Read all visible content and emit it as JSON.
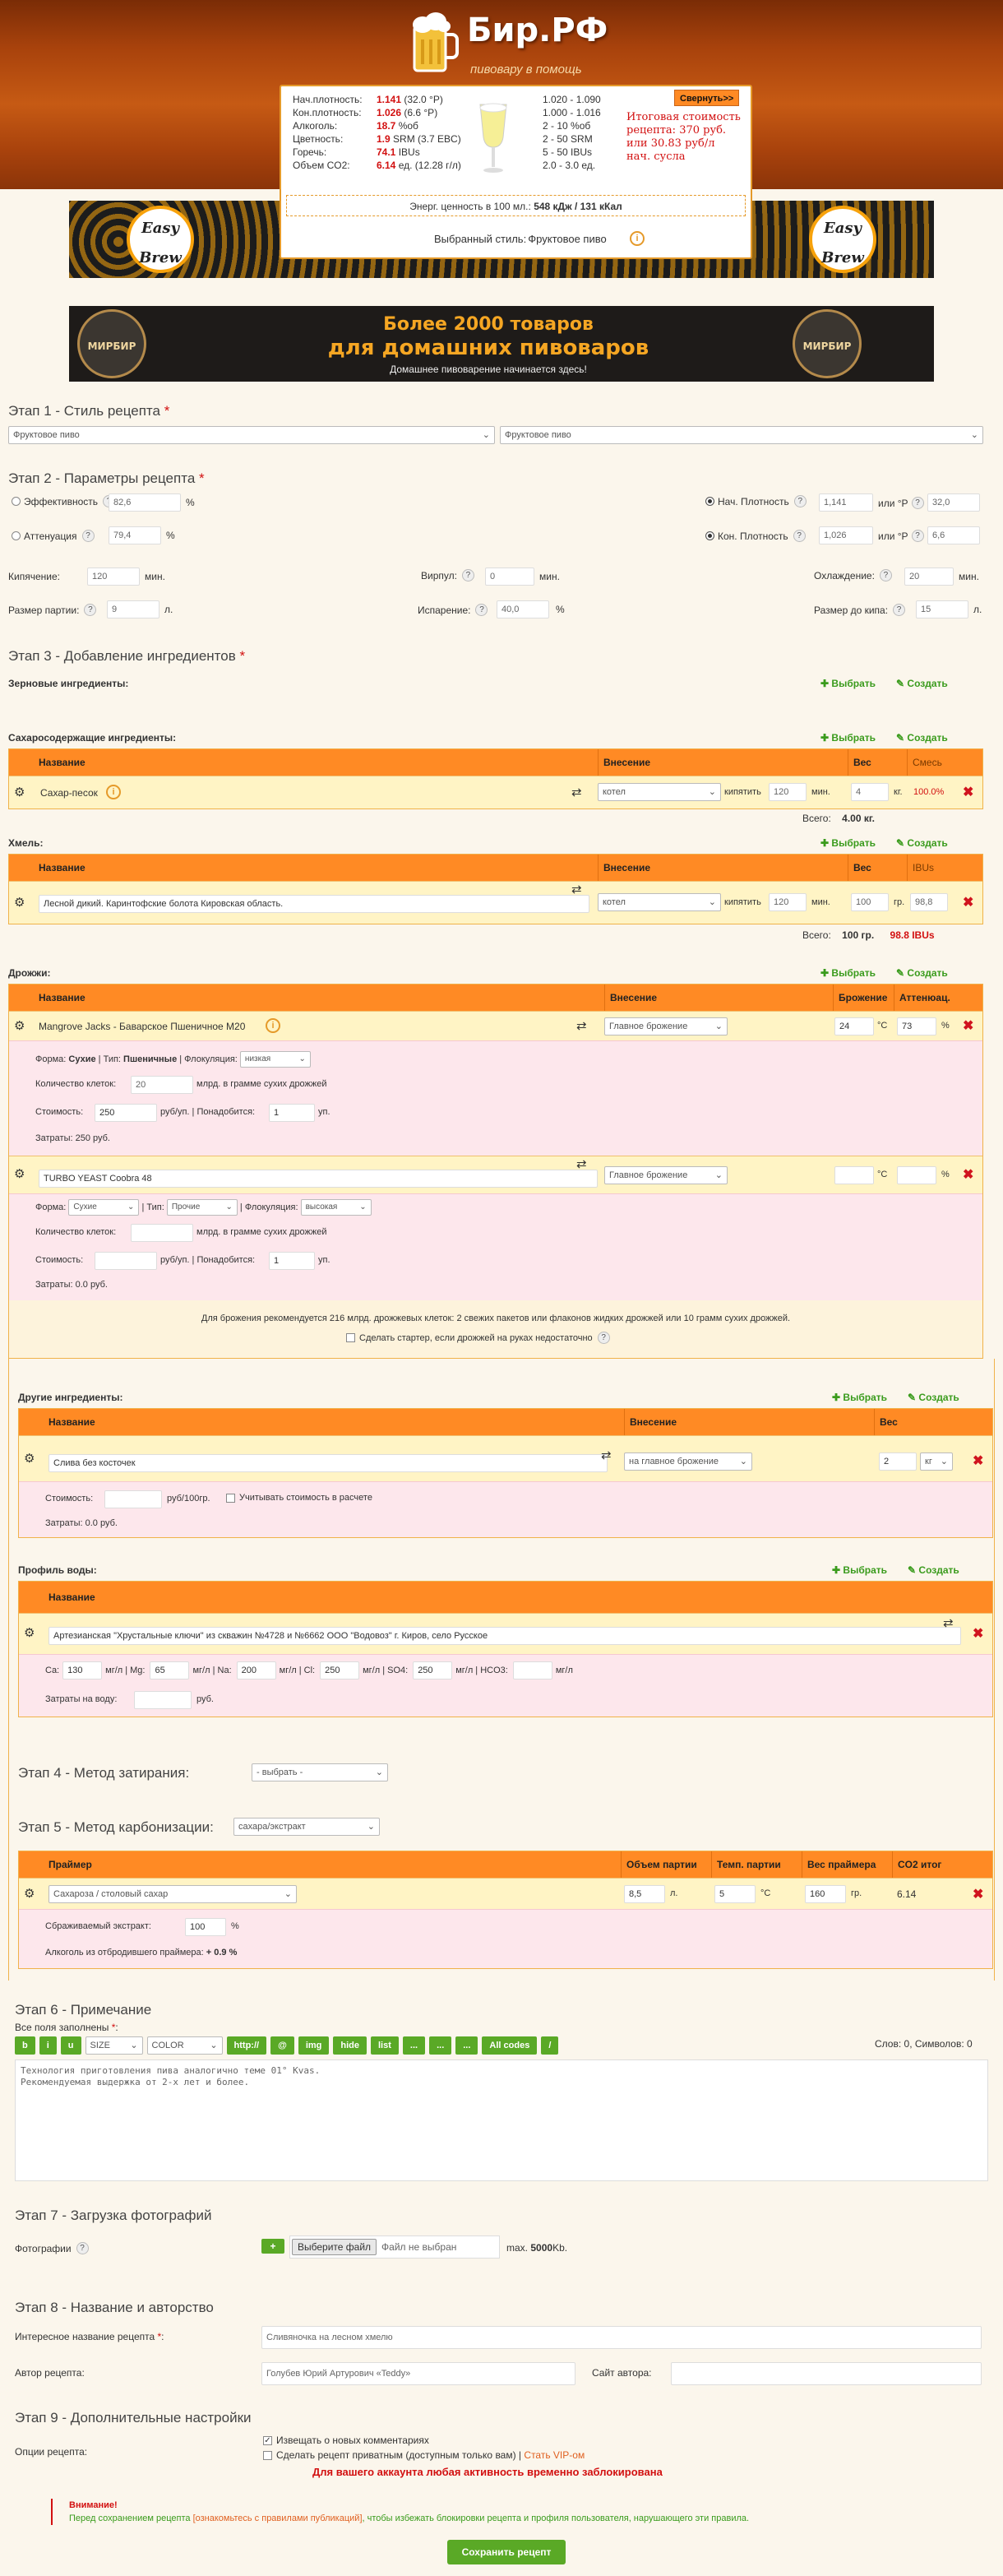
{
  "header": {
    "title": "Бир.РФ",
    "subtitle": "пивовару в помощь"
  },
  "calc": {
    "og_label": "Нач.плотность:",
    "og_value": "1.141",
    "og_extra": "(32.0 °P)",
    "og_range": "1.020 - 1.090",
    "fg_label": "Кон.плотность:",
    "fg_value": "1.026",
    "fg_extra": "(6.6 °P)",
    "fg_range": "1.000 - 1.016",
    "abv_label": "Алкоголь:",
    "abv_value": "18.7",
    "abv_unit": "%об",
    "abv_range": "2 - 10 %об",
    "color_label": "Цветность:",
    "color_value": "1.9",
    "color_unit": "SRM (3.7 EBC)",
    "color_range": "2 - 50 SRM",
    "ibu_label": "Горечь:",
    "ibu_value": "74.1",
    "ibu_unit": "IBUs",
    "ibu_range": "5 - 50 IBUs",
    "co2_label": "Объем CO2:",
    "co2_value": "6.14",
    "co2_unit": "ед. (12.28 г/л)",
    "co2_range": "2.0 - 3.0 ед.",
    "collapse": "Свернуть>>",
    "cost": "Итоговая стоимость рецепта: 370 руб. или 30.83 руб/л нач. сусла",
    "energy_label": "Энерг. ценность в 100 мл.:",
    "energy_value": "548 кДж / 131 кКал",
    "style_label": "Выбранный стиль:",
    "style_value": "Фруктовое пиво"
  },
  "banners": {
    "easybrew": "Easy Brew",
    "mirbir_logo": "МИРБИР",
    "mirbir_line1": "Более 2000 товаров",
    "mirbir_line2": "для домашних пивоваров",
    "mirbir_line3": "Домашнее пивоварение начинается здесь!"
  },
  "stage1": {
    "title": "Этап 1 - Стиль рецепта",
    "style1": "Фруктовое пиво",
    "style2": "Фруктовое пиво"
  },
  "stage2": {
    "title": "Этап 2 - Параметры рецепта",
    "efficiency_label": "Эффективность",
    "efficiency_value": "82,6",
    "pct": "%",
    "attenuation_label": "Аттенуация",
    "attenuation_value": "79,4",
    "og_label": "Нач. Плотность",
    "og_value": "1,141",
    "og_or": "или °P",
    "og_p": "32,0",
    "fg_label": "Кон. Плотность",
    "fg_value": "1,026",
    "fg_or": "или °P",
    "fg_p": "6,6",
    "boil_label": "Кипячение:",
    "boil_value": "120",
    "min": "мин.",
    "whirlpool_label": "Вирпул:",
    "whirlpool_value": "0",
    "cooling_label": "Охлаждение:",
    "cooling_value": "20",
    "batch_label": "Размер партии:",
    "batch_value": "9",
    "liter": "л.",
    "evap_label": "Испарение:",
    "evap_value": "40,0",
    "evap_unit": "%",
    "preboil_label": "Размер до кипа:",
    "preboil_value": "15"
  },
  "stage3": {
    "title": "Этап 3 - Добавление ингредиентов",
    "grains_label": "Зерновые ингредиенты:",
    "select": "Выбрать",
    "create": "Создать",
    "sugars_label": "Сахаросодержащие ингредиенты:",
    "sugar_headers": {
      "name": "Название",
      "addition": "Внесение",
      "weight": "Вес",
      "mix": "Смесь"
    },
    "sugar_row": {
      "name": "Сахар-песок",
      "addition": "котел",
      "boil": "кипятить",
      "time": "120",
      "min": "мин.",
      "weight": "4",
      "unit": "кг.",
      "mix": "100.0%"
    },
    "sugar_total": "Всего:",
    "sugar_total_value": "4.00 кг.",
    "hops_label": "Хмель:",
    "hop_headers": {
      "name": "Название",
      "addition": "Внесение",
      "weight": "Вес",
      "ibu": "IBUs"
    },
    "hop_row": {
      "name": "Лесной дикий. Каринтофские болота Кировская область.",
      "addition": "котел",
      "boil": "кипятить",
      "time": "120",
      "min": "мин.",
      "weight": "100",
      "unit": "гр.",
      "ibu": "98,8"
    },
    "hop_total": "Всего:",
    "hop_total_weight": "100 гр.",
    "hop_total_ibu": "98.8 IBUs",
    "yeast_label": "Дрожжи:",
    "yeast_headers": {
      "name": "Название",
      "addition": "Внесение",
      "ferment": "Брожение",
      "atten": "Аттенюац."
    },
    "yeast1": {
      "name": "Mangrove Jacks - Баварское Пшеничное M20",
      "addition": "Главное брожение",
      "temp": "24",
      "deg": "°C",
      "atten": "73",
      "pct": "%",
      "form_line": "Форма:",
      "form": "Сухие",
      "type_label": "| Тип:",
      "type": "Пшеничные",
      "floc_label": "| Флокуляция:",
      "floc": "низкая",
      "cells_label": "Количество клеток:",
      "cells_value": "20",
      "cells_unit": "млрд. в грамме сухих дрожжей",
      "cost_label": "Стоимость:",
      "cost_value": "250",
      "cost_unit": "руб/уп. | Понадобится:",
      "need_value": "1",
      "need_unit": "уп.",
      "spent": "Затраты: 250 руб."
    },
    "yeast2": {
      "name": "TURBO YEAST Coobra 48",
      "addition": "Главное брожение",
      "deg": "°C",
      "pct": "%",
      "form_label": "Форма:",
      "form": "Сухие",
      "type_label": "| Тип:",
      "type": "Прочие",
      "floc_label": "| Флокуляция:",
      "floc": "высокая",
      "cells_label": "Количество клеток:",
      "cells_unit": "млрд. в грамме сухих дрожжей",
      "cost_label": "Стоимость:",
      "cost_unit": "руб/уп. | Понадобится:",
      "need_value": "1",
      "need_unit": "уп.",
      "spent": "Затраты: 0.0 руб."
    },
    "yeast_note": "Для брожения рекомендуется 216 млрд. дрожжевых клеток: 2 свежих пакетов или флаконов жидких дрожжей или 10 грамм сухих дрожжей.",
    "starter": "Сделать стартер, если дрожжей на руках недостаточно",
    "other_label": "Другие ингредиенты:",
    "other_headers": {
      "name": "Название",
      "addition": "Внесение",
      "weight": "Вес"
    },
    "other_row": {
      "name": "Слива без косточек",
      "addition": "на главное брожение",
      "weight": "2",
      "unit": "кг"
    },
    "other_cost_label": "Стоимость:",
    "other_cost_unit": "руб/100гр.",
    "other_include": "Учитывать стоимость в расчете",
    "other_spent": "Затраты: 0.0 руб.",
    "water_label": "Профиль воды:",
    "water_header": "Название",
    "water_row": "Артезианская \"Хрустальные ключи\" из скважин №4728 и №6662 ООО \"Водовоз\" г. Киров, село Русское",
    "water_ions": [
      {
        "label": "Ca:",
        "value": "130",
        "unit": "мг/л | Mg:"
      },
      {
        "label": "",
        "value": "65",
        "unit": "мг/л | Na:"
      },
      {
        "label": "",
        "value": "200",
        "unit": "мг/л | Cl:"
      },
      {
        "label": "",
        "value": "250",
        "unit": "мг/л | SO4:"
      },
      {
        "label": "",
        "value": "250",
        "unit": "мг/л | HCO3:"
      },
      {
        "label": "",
        "value": "",
        "unit": "мг/л"
      }
    ],
    "water_cost_label": "Затраты на воду:",
    "water_cost_unit": "руб."
  },
  "stage4": {
    "title": "Этап 4 - Метод затирания:",
    "value": "- выбрать -"
  },
  "stage5": {
    "title": "Этап 5 - Метод карбонизации:",
    "value": "сахара/экстракт",
    "headers": {
      "primer": "Праймер",
      "volume": "Объем партии",
      "temp": "Темп. партии",
      "weight": "Вес праймера",
      "co2": "CO2 итог"
    },
    "row": {
      "primer": "Сахароза / столовый сахар",
      "volume": "8,5",
      "l": "л.",
      "temp": "5",
      "deg": "°C",
      "weight": "160",
      "gr": "гр.",
      "co2": "6.14"
    },
    "extract_label": "Сбраживаемый экстракт:",
    "extract_value": "100",
    "extract_unit": "%",
    "alc_label": "Алкоголь из отбродившего праймера:",
    "alc_value": "+ 0.9 %"
  },
  "stage6": {
    "title": "Этап 6 - Примечание",
    "required": "Все поля заполнены",
    "buttons": [
      "b",
      "i",
      "u"
    ],
    "size": "SIZE",
    "color": "COLOR",
    "buttons2": [
      "http://",
      "@",
      "img",
      "hide",
      "list",
      "...",
      "...",
      "...",
      "All codes",
      "/"
    ],
    "counter": "Слов: 0, Символов: 0",
    "text1": "Технология приготовления пива аналогично теме 01° Kvas.",
    "text2": "Рекомендуемая выдержка от 2-х лет и более."
  },
  "stage7": {
    "title": "Этап 7 - Загрузка фотографий",
    "photos_label": "Фотографии",
    "plus": "+",
    "choose": "Выберите файл",
    "no_file": "Файл не выбран",
    "max": "max.",
    "max_value": "5000",
    "max_unit": "Kb."
  },
  "stage8": {
    "title": "Этап 8 - Название и авторство",
    "name_label": "Интересное название рецепта",
    "name_value": "Сливяночка на лесном хмелю",
    "author_label": "Автор рецепта:",
    "author_value": "Голубев Юрий Артурович «Teddy»",
    "site_label": "Сайт автора:"
  },
  "stage9": {
    "title": "Этап 9 - Дополнительные настройки",
    "options_label": "Опции рецепта:",
    "notify": "Извещать о новых комментариях",
    "private": "Сделать рецепт приватным (доступным только вам) |",
    "vip": "Стать VIP-ом",
    "blocked": "Для вашего аккаунта любая активность временно заблокирована"
  },
  "warning": {
    "title": "Внимание!",
    "text1": "Перед сохранением рецепта",
    "link": "ознакомьтесь с правилами публикаций",
    "text2": ", чтобы избежать блокировки рецепта и профиля пользователя, нарушающего эти правила."
  },
  "save": "Сохранить рецепт"
}
